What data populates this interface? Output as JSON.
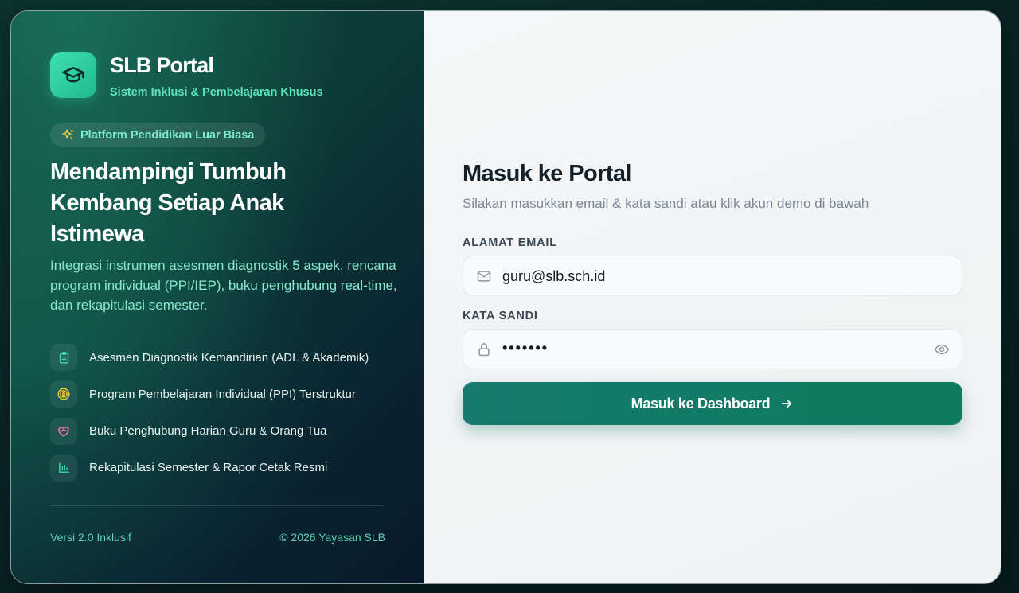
{
  "brand": {
    "title": "SLB Portal",
    "subtitle": "Sistem Inklusi & Pembelajaran Khusus",
    "logo_icon": "graduation-cap-icon"
  },
  "hero": {
    "pill_label": "Platform Pendidikan Luar Biasa",
    "pill_icon": "sparkles-icon",
    "headline": "Mendampingi Tumbuh Kembang Setiap Anak Istimewa",
    "description": "Integrasi instrumen asesmen diagnostik 5 aspek, rencana program individual (PPI/IEP), buku penghubung real-time, dan rekapitulasi semester."
  },
  "features": [
    {
      "label": "Asesmen Diagnostik Kemandirian (ADL & Akademik)",
      "icon": "clipboard-icon",
      "color": "#3fd9ae"
    },
    {
      "label": "Program Pembelajaran Individual (PPI) Terstruktur",
      "icon": "target-icon",
      "color": "#e9c93a"
    },
    {
      "label": "Buku Penghubung Harian Guru & Orang Tua",
      "icon": "heart-handshake-icon",
      "color": "#f07a9b"
    },
    {
      "label": "Rekapitulasi Semester & Rapor Cetak Resmi",
      "icon": "bar-chart-icon",
      "color": "#3fd9ae"
    }
  ],
  "footer": {
    "version": "Versi 2.0 Inklusif",
    "copyright": "© 2026 Yayasan SLB"
  },
  "login": {
    "title": "Masuk ke Portal",
    "subtitle": "Silakan masukkan email & kata sandi atau klik akun demo di bawah",
    "email_label": "ALAMAT EMAIL",
    "email_value": "guru@slb.sch.id",
    "password_label": "KATA SANDI",
    "password_value": "•••••••",
    "submit_label": "Masuk ke Dashboard"
  },
  "colors": {
    "accent": "#167a6c",
    "brand_mint": "#3ee0b5",
    "left_panel": "#0c3a38"
  }
}
